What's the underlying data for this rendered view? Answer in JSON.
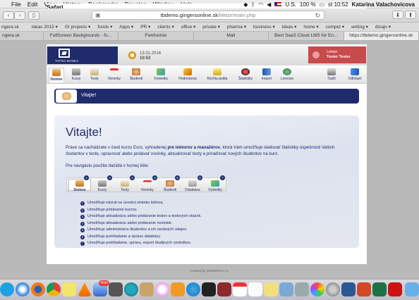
{
  "menubar": {
    "app": "Safari",
    "items": [
      "File",
      "Edit",
      "View",
      "History",
      "Bookmarks",
      "Develop",
      "Window",
      "Help"
    ],
    "input_source": "U.S.",
    "battery": "100 %",
    "clock": "st 10:52",
    "user": "Katarina Valachovicova"
  },
  "browser": {
    "url_prefix": "tbdemo.gingersonline.sk",
    "url_path": "/lektor/main.php",
    "bookmarks": [
      "ngera.sk",
      "ideas 2015 ▾",
      "GI projects ▾",
      "funds ▾",
      "Apps ▾",
      "PR ▾",
      "clients ▾",
      "office ▾",
      "private ▾",
      "pharma ▾",
      "business ▾",
      "ideas ▾",
      "home ▾",
      "compet ▾",
      "writing ▾",
      "dizajn ▾"
    ],
    "tabs": [
      {
        "label": "ngera.sk",
        "active": false
      },
      {
        "label": "FullScreen Backgrounds - fu...",
        "active": false
      },
      {
        "label": "Fivefootsix",
        "active": false
      },
      {
        "label": "Mail",
        "active": false
      },
      {
        "label": "Best SaaS Cloud LMS for En...",
        "active": false
      },
      {
        "label": "https://tbdemo.gingersonline.sk",
        "active": true
      }
    ]
  },
  "header": {
    "logo_text": "TATRA BANKA",
    "date": "13.01.2016",
    "time": "10:53",
    "role": "Lektor",
    "username": "Tester Tester"
  },
  "nav": {
    "items": [
      "Domov",
      "Kurzy",
      "Testy",
      "Novinky",
      "Študenti",
      "Výsledky",
      "Hodnotenia",
      "Rýchla pošta",
      "Štatistiky",
      "Import",
      "Licencie",
      "Tlačiť",
      "Odhlásiť"
    ]
  },
  "banner": {
    "title": "Vitajte!"
  },
  "content": {
    "title": "Vitajte!",
    "intro_pre": "Práve sa nachádzate v časti kurzu Euro, vyhradenej ",
    "intro_bold": "pre lektorov a manažérov",
    "intro_post": ", ktorá Vám umožňuje sledovať štatistiky úspešnosti Vašich študentov v teste, upravovať alebo pridávať novinky, aktualizovať testy a priraďovať nových študentov na kurz.",
    "subtitle": "Pre navigáciu použite tlačidlá v hornej lište:",
    "mini_nav": [
      {
        "num": "1",
        "label": "Domov"
      },
      {
        "num": "2",
        "label": "Kurzy"
      },
      {
        "num": "3",
        "label": "Testy"
      },
      {
        "num": "4",
        "label": "Novinky"
      },
      {
        "num": "5",
        "label": "Študenti"
      },
      {
        "num": "6",
        "label": "Databáza"
      },
      {
        "num": "7",
        "label": "Výsledky"
      }
    ],
    "list": [
      {
        "num": "1",
        "text": "Umožňuje návrat na úvodnú stránku lektora."
      },
      {
        "num": "2",
        "text": "Umožňuje pridávanie kurzov."
      },
      {
        "num": "3",
        "text": "Umožňuje aktualizáciu alebo pridávanie testov a testových otázok."
      },
      {
        "num": "4",
        "text": "Umožňuje aktualizáciu alebo pridávanie noviniek."
      },
      {
        "num": "5",
        "text": "Umožňuje administráciu študentov a ich osobných údajov."
      },
      {
        "num": "6",
        "text": "Umožňuje prehliadanie a úpravu databázy."
      },
      {
        "num": "7",
        "text": "Umožňuje prehliadanie, správu, export študijných výsledkov."
      }
    ]
  },
  "footer": {
    "text": "Created by GINGERS s.r.o."
  },
  "dock": {
    "mail_badge": "4590"
  },
  "colors": {
    "brand_navy": "#1f2b6b",
    "user_red": "#c84a4a"
  }
}
